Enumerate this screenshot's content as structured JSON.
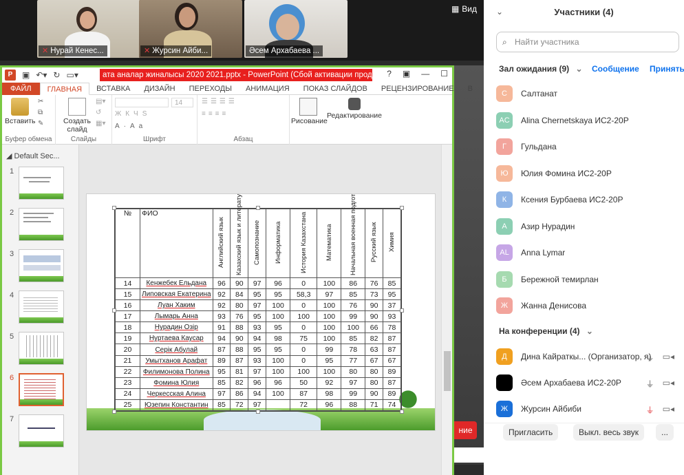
{
  "video_tiles": [
    {
      "name": "Нурай Кенес..."
    },
    {
      "name": "Журсин Айби..."
    },
    {
      "name": "Әсем Архабаева ..."
    }
  ],
  "view_label": "Вид",
  "share": {
    "stop_label": "ние"
  },
  "ppt": {
    "title": "ата аналар жиналысы 2020 2021.pptx - PowerPoint (Сбой активации продук...",
    "logo": "P",
    "tabs": [
      "ФАЙЛ",
      "ГЛАВНАЯ",
      "ВСТАВКА",
      "ДИЗАЙН",
      "ПЕРЕХОДЫ",
      "АНИМАЦИЯ",
      "ПОКАЗ СЛАЙДОВ",
      "РЕЦЕНЗИРОВАНИЕ",
      "В"
    ],
    "ribbon": {
      "paste": "Вставить",
      "new_slide": "Создать слайд",
      "groups": [
        "Буфер обмена",
        "Слайды",
        "Шрифт",
        "Абзац"
      ],
      "font_size": "14",
      "drawing": "Рисование",
      "editing": "Редактирование"
    },
    "section": "Default Sec...",
    "slide_numbers": [
      "1",
      "2",
      "3",
      "4",
      "5",
      "6",
      "7"
    ],
    "table": {
      "num_header": "№",
      "name_header": "ФИО",
      "subjects": [
        "Английский язык",
        "Казахский язык и литература",
        "Самопознание",
        "Информатика",
        "История Казахстана",
        "Математика",
        "Начальная военная подготовка",
        "Русский язык",
        "Химия"
      ],
      "rows": [
        {
          "n": "14",
          "name": "Кенжебек Ельдана",
          "v": [
            "96",
            "90",
            "97",
            "96",
            "0",
            "100",
            "86",
            "76",
            "85"
          ]
        },
        {
          "n": "15",
          "name": "Липовская Екатерина",
          "v": [
            "92",
            "84",
            "95",
            "95",
            "58,3",
            "97",
            "85",
            "73",
            "95"
          ]
        },
        {
          "n": "16",
          "name": "Луан Хаким",
          "v": [
            "92",
            "80",
            "97",
            "100",
            "0",
            "100",
            "76",
            "90",
            "37"
          ]
        },
        {
          "n": "17",
          "name": "Лымарь Анна",
          "v": [
            "93",
            "76",
            "95",
            "100",
            "100",
            "100",
            "99",
            "90",
            "93"
          ]
        },
        {
          "n": "18",
          "name": "Нурадин Озір",
          "v": [
            "91",
            "88",
            "93",
            "95",
            "0",
            "100",
            "100",
            "66",
            "78"
          ]
        },
        {
          "n": "19",
          "name": "Нуртаева Каусар",
          "v": [
            "94",
            "90",
            "94",
            "98",
            "75",
            "100",
            "85",
            "82",
            "87"
          ]
        },
        {
          "n": "20",
          "name": "Серік Абулай",
          "v": [
            "87",
            "88",
            "95",
            "95",
            "0",
            "99",
            "78",
            "63",
            "87"
          ]
        },
        {
          "n": "21",
          "name": "Умытханов Арафат",
          "v": [
            "89",
            "87",
            "93",
            "100",
            "0",
            "95",
            "77",
            "67",
            "67"
          ]
        },
        {
          "n": "22",
          "name": "Филимонова Полина",
          "v": [
            "95",
            "81",
            "97",
            "100",
            "100",
            "100",
            "80",
            "80",
            "89"
          ]
        },
        {
          "n": "23",
          "name": "Фомина Юлия",
          "v": [
            "85",
            "82",
            "96",
            "96",
            "50",
            "92",
            "97",
            "80",
            "87"
          ]
        },
        {
          "n": "24",
          "name": "Черкесская Алина",
          "v": [
            "97",
            "86",
            "94",
            "100",
            "87",
            "98",
            "99",
            "90",
            "89"
          ]
        },
        {
          "n": "25",
          "name": "Юзепин Константин",
          "v": [
            "85",
            "72",
            "97",
            "",
            "72",
            "96",
            "88",
            "71",
            "74"
          ]
        }
      ]
    }
  },
  "participants": {
    "title": "Участники (4)",
    "search_placeholder": "Найти участника",
    "waiting_label": "Зал ожидания (9)",
    "message_link": "Сообщение",
    "admit_link": "Принять",
    "waiting": [
      {
        "initial": "С",
        "name": "Салтанат",
        "color": "#f6b89a"
      },
      {
        "initial": "AC",
        "name": "Alina Chernetskaya ИС2-20Р",
        "color": "#8ccfb3"
      },
      {
        "initial": "Г",
        "name": "Гульдана",
        "color": "#f2a49c"
      },
      {
        "initial": "Ю",
        "name": "Юлия Фомина ИС2-20Р",
        "color": "#f6b89a"
      },
      {
        "initial": "К",
        "name": "Ксения Бурбаева ИС2-20Р",
        "color": "#8fb4e6"
      },
      {
        "initial": "А",
        "name": "Азир Нурадин",
        "color": "#8ccfb3"
      },
      {
        "initial": "AL",
        "name": "Anna Lymar",
        "color": "#c6a6e6"
      },
      {
        "initial": "Б",
        "name": "Бережной темирлан",
        "color": "#a6dab0"
      },
      {
        "initial": "Ж",
        "name": "Жанна Денисова",
        "color": "#f2a49c"
      }
    ],
    "in_meeting_label": "На конференции (4)",
    "in_meeting": [
      {
        "initial": "Д",
        "name": "Дина Кайраткы... (Организатор, я)",
        "color": "#f0a020"
      },
      {
        "initial": "",
        "name": "Әсем Архабаева ИС2-20Р",
        "color": "#000000"
      },
      {
        "initial": "Ж",
        "name": "Журсин Айбиби",
        "color": "#1a6fd8"
      }
    ],
    "invite": "Пригласить",
    "mute_all": "Выкл. весь звук",
    "more": "..."
  }
}
